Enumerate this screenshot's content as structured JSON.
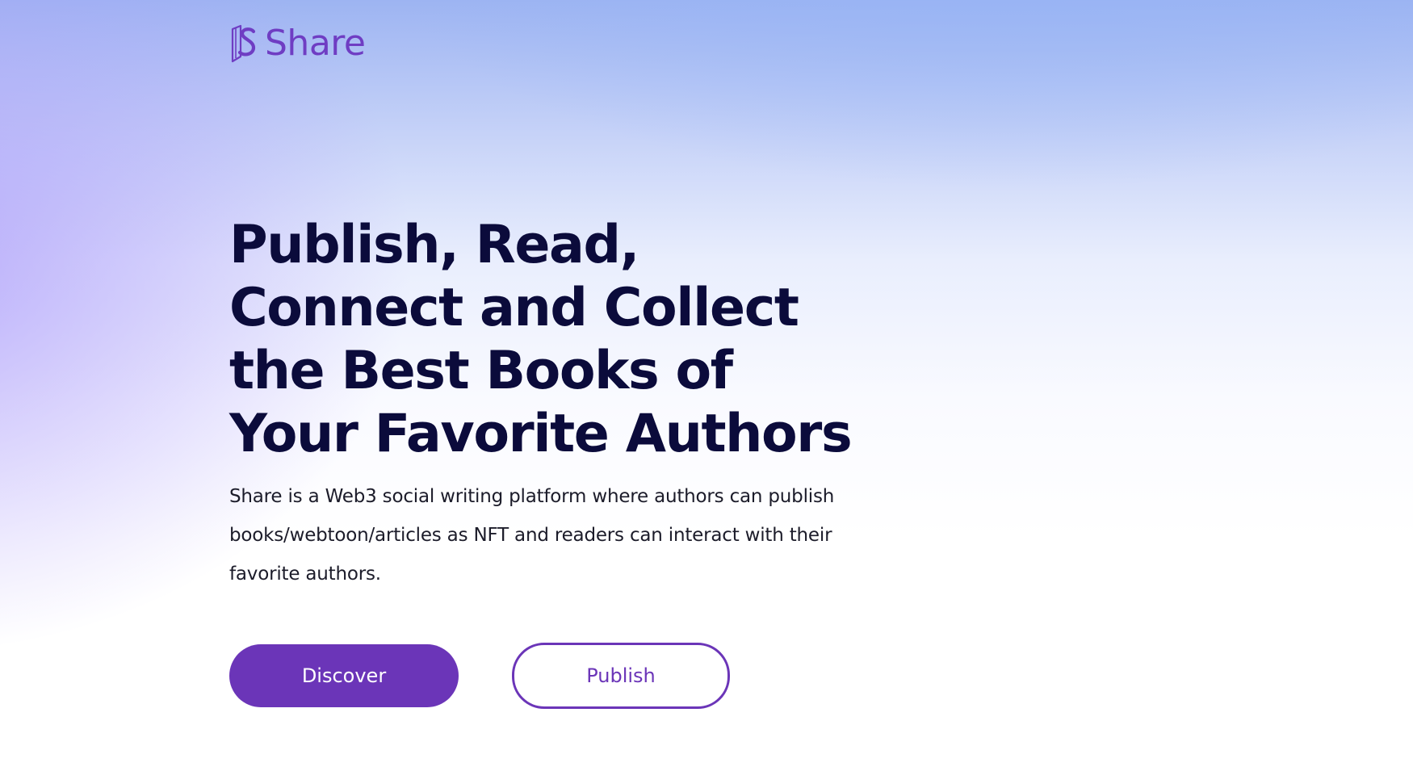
{
  "brand": {
    "name": "Share",
    "logo_icon": "book-s-icon",
    "accent_color": "#6b35b8"
  },
  "hero": {
    "title": "Publish, Read, Connect and Collect the Best Books of Your Favorite Authors",
    "description": "Share is a Web3 social writing platform where authors can publish books/webtoon/articles as NFT and readers can interact with their favorite authors."
  },
  "actions": {
    "discover_label": "Discover",
    "publish_label": "Publish"
  }
}
